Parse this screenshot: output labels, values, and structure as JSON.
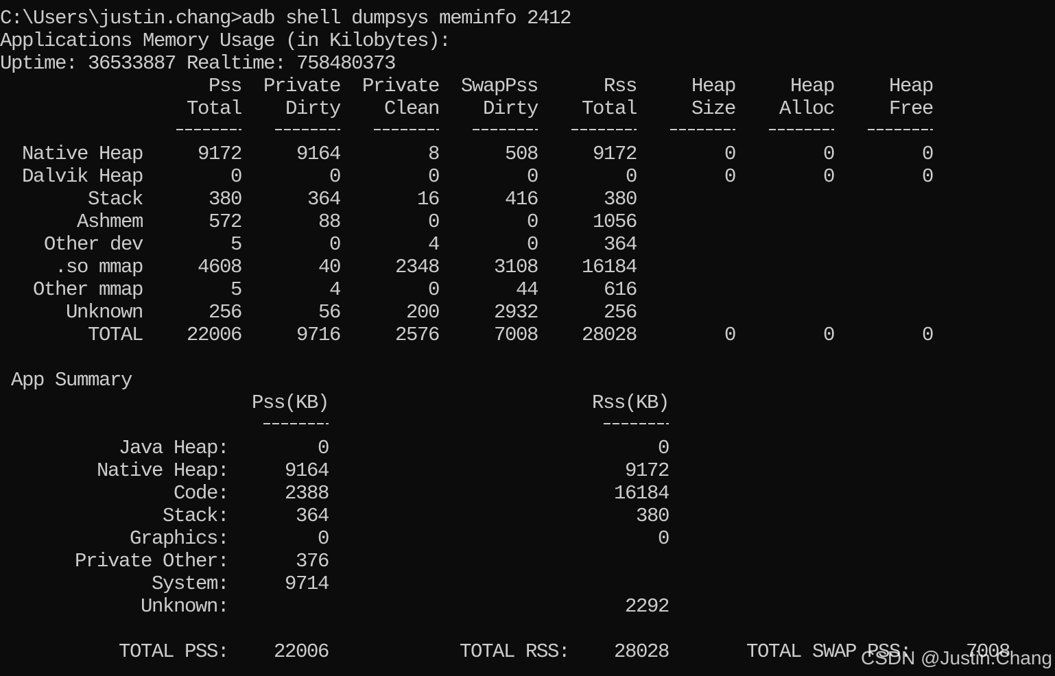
{
  "terminal": {
    "command_line": "C:\\Users\\justin.chang>adb shell dumpsys meminfo 2412",
    "heading": "Applications Memory Usage (in Kilobytes):",
    "uptime_line": "Uptime: 36533887 Realtime: 758480373"
  },
  "meminfo_table": {
    "headers_top": [
      "Pss",
      "Private",
      "Private",
      "SwapPss",
      "Rss",
      "Heap",
      "Heap",
      "Heap"
    ],
    "headers_bottom": [
      "Total",
      "Dirty",
      "Clean",
      "Dirty",
      "Total",
      "Size",
      "Alloc",
      "Free"
    ],
    "separator": "------",
    "rows": [
      {
        "label": "Native Heap",
        "values": [
          "9172",
          "9164",
          "8",
          "508",
          "9172",
          "0",
          "0",
          "0"
        ]
      },
      {
        "label": "Dalvik Heap",
        "values": [
          "0",
          "0",
          "0",
          "0",
          "0",
          "0",
          "0",
          "0"
        ]
      },
      {
        "label": "Stack",
        "values": [
          "380",
          "364",
          "16",
          "416",
          "380",
          "",
          "",
          ""
        ]
      },
      {
        "label": "Ashmem",
        "values": [
          "572",
          "88",
          "0",
          "0",
          "1056",
          "",
          "",
          ""
        ]
      },
      {
        "label": "Other dev",
        "values": [
          "5",
          "0",
          "4",
          "0",
          "364",
          "",
          "",
          ""
        ]
      },
      {
        "label": ".so mmap",
        "values": [
          "4608",
          "40",
          "2348",
          "3108",
          "16184",
          "",
          "",
          ""
        ]
      },
      {
        "label": "Other mmap",
        "values": [
          "5",
          "4",
          "0",
          "44",
          "616",
          "",
          "",
          ""
        ]
      },
      {
        "label": "Unknown",
        "values": [
          "256",
          "56",
          "200",
          "2932",
          "256",
          "",
          "",
          ""
        ]
      },
      {
        "label": "TOTAL",
        "values": [
          "22006",
          "9716",
          "2576",
          "7008",
          "28028",
          "0",
          "0",
          "0"
        ]
      }
    ]
  },
  "app_summary": {
    "title": "App Summary",
    "pss_header": "Pss(KB)",
    "rss_header": "Rss(KB)",
    "separator": "------",
    "rows": [
      {
        "label": "Java Heap:",
        "pss": "0",
        "rss": "0"
      },
      {
        "label": "Native Heap:",
        "pss": "9164",
        "rss": "9172"
      },
      {
        "label": "Code:",
        "pss": "2388",
        "rss": "16184"
      },
      {
        "label": "Stack:",
        "pss": "364",
        "rss": "380"
      },
      {
        "label": "Graphics:",
        "pss": "0",
        "rss": "0"
      },
      {
        "label": "Private Other:",
        "pss": "376",
        "rss": ""
      },
      {
        "label": "System:",
        "pss": "9714",
        "rss": ""
      },
      {
        "label": "Unknown:",
        "pss": "",
        "rss": "2292"
      }
    ],
    "totals": {
      "total_pss_label": "TOTAL PSS:",
      "total_pss_value": "22006",
      "total_rss_label": "TOTAL RSS:",
      "total_rss_value": "28028",
      "total_swap_pss_label": "TOTAL SWAP PSS:",
      "total_swap_pss_value": "7008"
    }
  },
  "watermark": "CSDN @Justin.Chang",
  "colors": {
    "background": "#0c0c0c",
    "foreground": "#cccccc"
  }
}
